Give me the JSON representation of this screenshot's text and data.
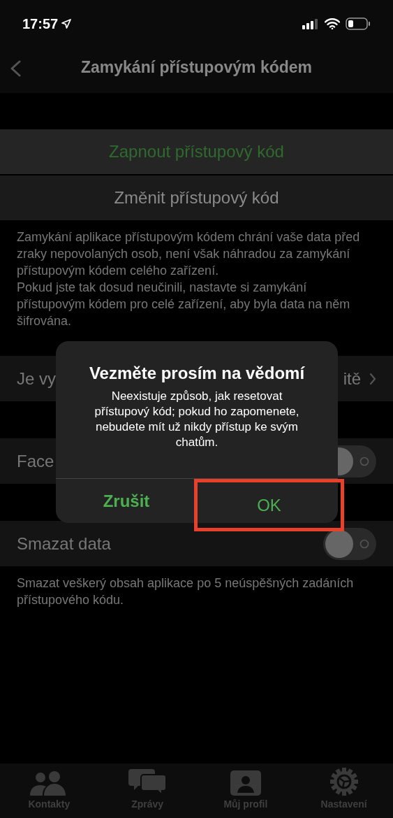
{
  "status_bar": {
    "time": "17:57"
  },
  "nav": {
    "title": "Zamykání přístupovým kódem"
  },
  "actions": [
    {
      "label": "Zapnout přístupový kód",
      "kind": "primary"
    },
    {
      "label": "Změnit přístupový kód",
      "kind": "plain"
    }
  ],
  "description": "Zamykání aplikace přístupovým kódem chrání vaše data před zraky nepovolaných osob, není však náhradou za zamykání přístupovým kódem celého zařízení.\nPokud jste tak dosud neučinili, nastavte si zamykání přístupovým kódem pro celé zařízení, aby byla data na něm šifrována.",
  "rows": [
    {
      "kind": "link",
      "label": "Je vy",
      "value": "itě"
    },
    {
      "kind": "toggle",
      "label": "Face",
      "on": false
    },
    {
      "kind": "toggle",
      "label": "Smazat data",
      "on": false,
      "note": "Smazat veškerý obsah aplikace po 5 neúspěšných zadáních přístupového kódu."
    }
  ],
  "alert": {
    "title": "Vezměte prosím na vědomí",
    "message": "Neexistuje způsob, jak resetovat přístupový kód; pokud ho zapomenete, nebudete mít už nikdy přístup ke svým chatům.",
    "buttons": [
      {
        "label": "Zrušit",
        "bold": true,
        "highlighted": false
      },
      {
        "label": "OK",
        "bold": false,
        "highlighted": true
      }
    ]
  },
  "tabs": [
    {
      "label": "Kontakty",
      "kind": "people"
    },
    {
      "label": "Zprávy",
      "kind": "chat"
    },
    {
      "label": "Můj profil",
      "kind": "profile"
    },
    {
      "label": "Nastavení",
      "kind": "gear"
    }
  ]
}
